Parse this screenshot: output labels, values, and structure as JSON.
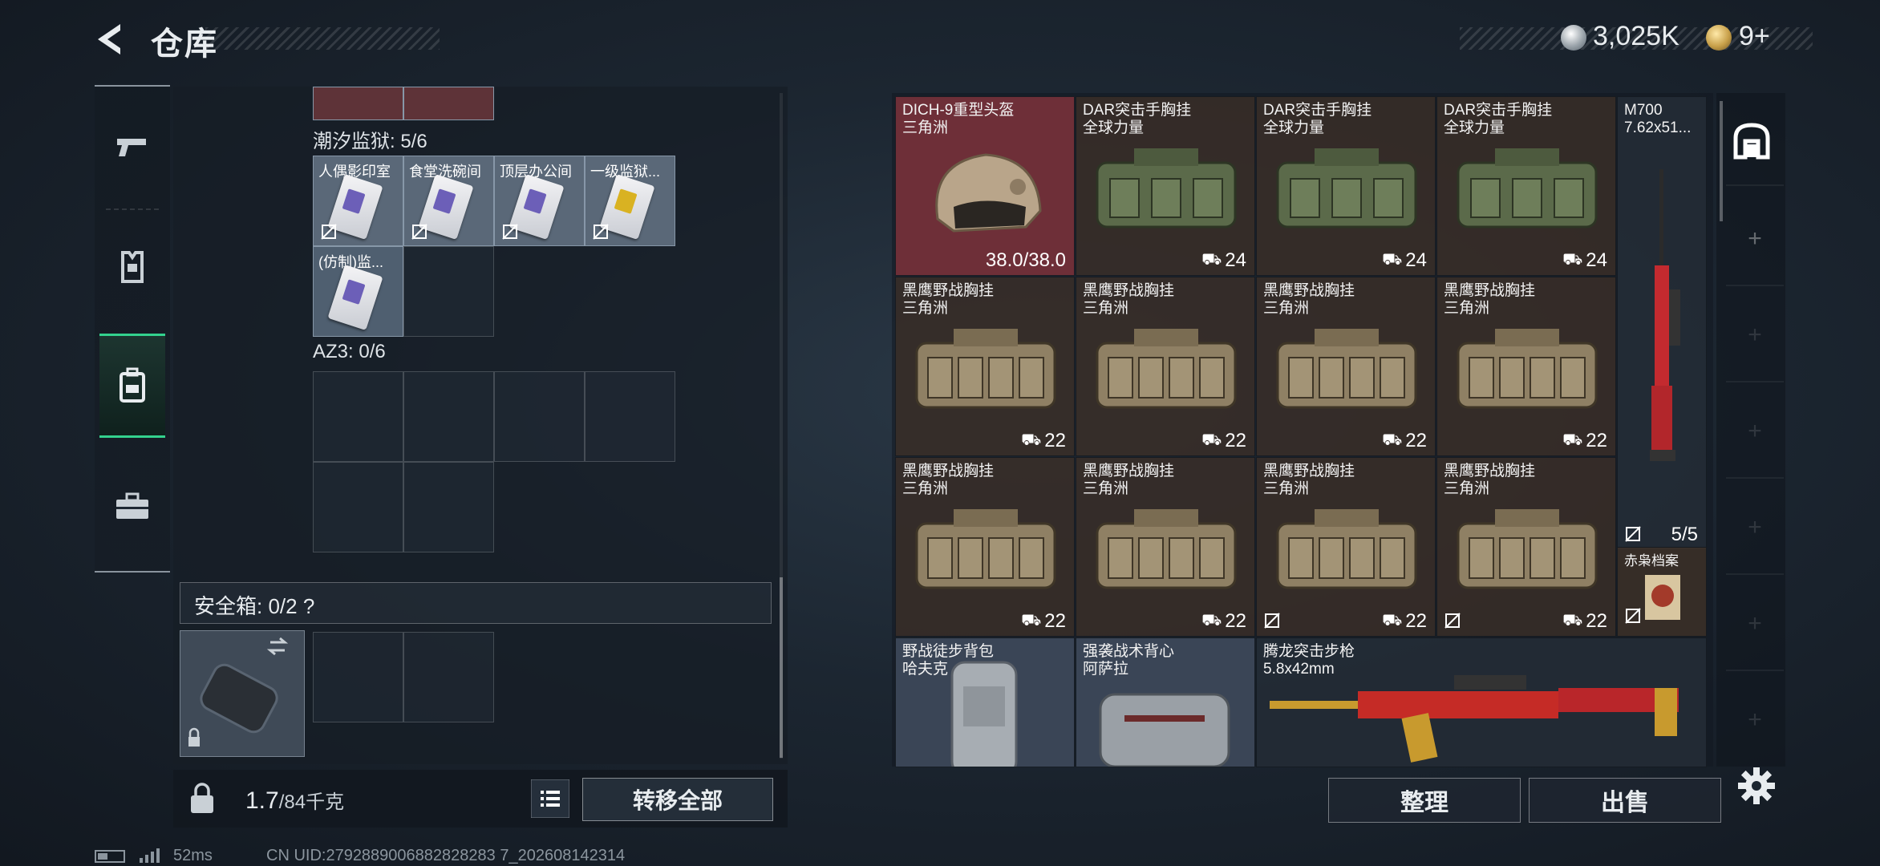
{
  "header": {
    "title": "仓库",
    "currency_primary": "3,025K",
    "currency_secondary": "9+"
  },
  "left": {
    "section_partial_count": "潮汐监狱: 5/6",
    "keys": [
      {
        "label": "人偶影印室",
        "color": "purple"
      },
      {
        "label": "食堂洗碗间",
        "color": "purple"
      },
      {
        "label": "顶层办公间",
        "color": "purple"
      },
      {
        "label": "一级监狱...",
        "color": "yellow"
      },
      {
        "label": "(仿制)监...",
        "color": "purple"
      }
    ],
    "section_az3": "AZ3: 0/6",
    "safe_box": "安全箱: 0/2  ?",
    "weight_value": "1.7",
    "weight_unit": "/84千克",
    "transfer_all": "转移全部"
  },
  "stash": {
    "row1": [
      {
        "name": "DICH-9重型头盔",
        "sub": "三角洲",
        "val": "38.0/38.0"
      },
      {
        "name": "DAR突击手胸挂",
        "sub": "全球力量",
        "val": "24"
      },
      {
        "name": "DAR突击手胸挂",
        "sub": "全球力量",
        "val": "24"
      },
      {
        "name": "DAR突击手胸挂",
        "sub": "全球力量",
        "val": "24"
      }
    ],
    "row2": [
      {
        "name": "黑鹰野战胸挂",
        "sub": "三角洲",
        "val": "22"
      },
      {
        "name": "黑鹰野战胸挂",
        "sub": "三角洲",
        "val": "22"
      },
      {
        "name": "黑鹰野战胸挂",
        "sub": "三角洲",
        "val": "22"
      },
      {
        "name": "黑鹰野战胸挂",
        "sub": "三角洲",
        "val": "22"
      }
    ],
    "row3": [
      {
        "name": "黑鹰野战胸挂",
        "sub": "三角洲",
        "val": "22"
      },
      {
        "name": "黑鹰野战胸挂",
        "sub": "三角洲",
        "val": "22"
      },
      {
        "name": "黑鹰野战胸挂",
        "sub": "三角洲",
        "val": "22"
      },
      {
        "name": "黑鹰野战胸挂",
        "sub": "三角洲",
        "val": "22"
      }
    ],
    "rifle": {
      "name": "M700",
      "sub": "7.62x51...",
      "count": "5/5"
    },
    "redbook": {
      "name": "赤枭档案"
    },
    "row4": [
      {
        "name": "野战徒步背包",
        "sub": "哈夫克"
      },
      {
        "name": "强袭战术背心",
        "sub": "阿萨拉"
      },
      {
        "name": "腾龙突击步枪",
        "sub": "5.8x42mm"
      }
    ],
    "sort": "整理",
    "sell": "出售"
  },
  "status": {
    "ping": "52ms",
    "uid": "CN UID:2792889006882828283 7_202608142314"
  },
  "build": "bbb in m",
  "colors": {
    "accent": "#33d28e",
    "helmet_bg": "#6e2f38",
    "item_bg": "#3c3028"
  }
}
